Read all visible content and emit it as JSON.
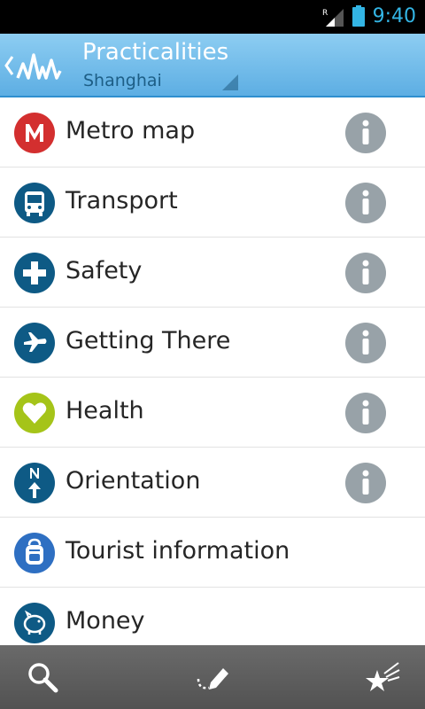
{
  "status_bar": {
    "time": "9:40",
    "signal_letter": "R"
  },
  "action_bar": {
    "title": "Practicalities",
    "subtitle": "Shanghai"
  },
  "list": {
    "items": [
      {
        "label": "Metro map",
        "icon": "metro-icon",
        "color": "#d32f2f",
        "has_info": true
      },
      {
        "label": "Transport",
        "icon": "bus-icon",
        "color": "#0e5a85",
        "has_info": true
      },
      {
        "label": "Safety",
        "icon": "plus-icon",
        "color": "#0e5a85",
        "has_info": true
      },
      {
        "label": "Getting There",
        "icon": "airplane-icon",
        "color": "#0e5a85",
        "has_info": true
      },
      {
        "label": "Health",
        "icon": "heart-icon",
        "color": "#a5c419",
        "has_info": true
      },
      {
        "label": "Orientation",
        "icon": "compass-icon",
        "color": "#0e5a85",
        "has_info": true
      },
      {
        "label": "Tourist information",
        "icon": "backpack-icon",
        "color": "#2e6fc2",
        "has_info": false
      },
      {
        "label": "Money",
        "icon": "piggy-bank-icon",
        "color": "#0e5a85",
        "has_info": false
      }
    ]
  },
  "bottom_bar": {
    "buttons": [
      "search-icon",
      "itinerary-icon",
      "favorites-icon"
    ]
  },
  "colors": {
    "accent": "#33b5e5",
    "info_icon": "#98a2a8",
    "action_bar": "#6fbce9"
  }
}
